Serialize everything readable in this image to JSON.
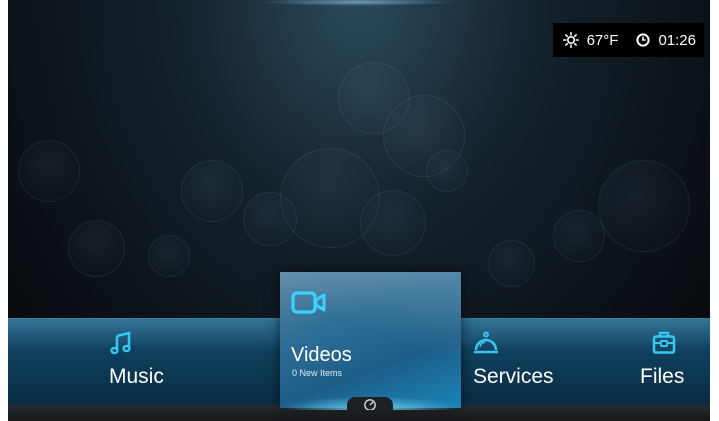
{
  "status": {
    "weather_icon": "sun-icon",
    "temperature": "67°F",
    "clock_icon": "clock-icon",
    "time": "01:26"
  },
  "menu": {
    "items": [
      {
        "label": "Music",
        "icon": "music-note-icon"
      },
      {
        "label": "Videos",
        "icon": "video-camera-icon",
        "subtitle": "0 New Items",
        "selected": true
      },
      {
        "label": "Services",
        "icon": "service-bell-icon"
      },
      {
        "label": "Files",
        "icon": "briefcase-icon"
      }
    ],
    "handle_icon": "dashboard-gauge-icon"
  },
  "colors": {
    "accent": "#36c6f0",
    "bar": "#0f3f5c",
    "card": "#2f6e96"
  }
}
